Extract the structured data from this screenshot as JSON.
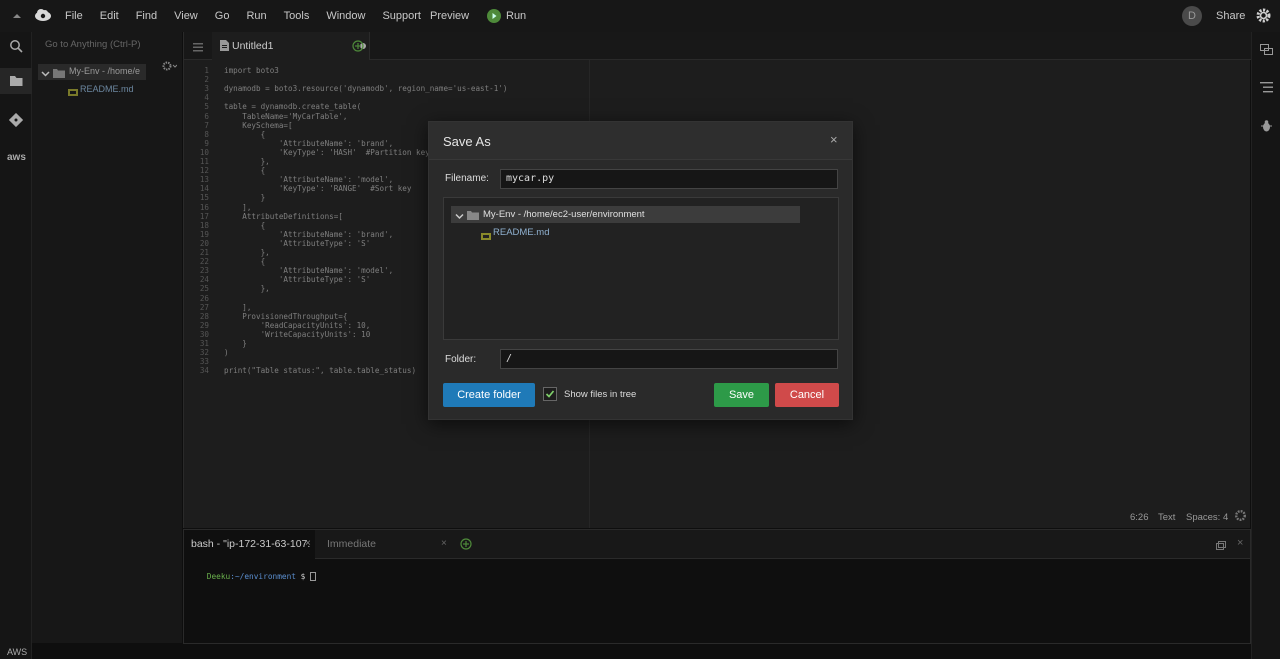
{
  "menubar": {
    "items": [
      "File",
      "Edit",
      "Find",
      "View",
      "Go",
      "Run",
      "Tools",
      "Window",
      "Support"
    ],
    "preview": "Preview",
    "run": "Run",
    "avatar_letter": "D",
    "share": "Share"
  },
  "tree": {
    "search_placeholder": "Go to Anything (Ctrl-P)",
    "root": "My-Env - /home/e",
    "file": "README.md"
  },
  "editor": {
    "tab_title": "Untitled1",
    "lines": [
      "import boto3",
      "",
      "dynamodb = boto3.resource('dynamodb', region_name='us-east-1')",
      "",
      "table = dynamodb.create_table(",
      "    TableName='MyCarTable',",
      "    KeySchema=[",
      "        {",
      "            'AttributeName': 'brand',",
      "            'KeyType': 'HASH'  #Partition key",
      "        },",
      "        {",
      "            'AttributeName': 'model',",
      "            'KeyType': 'RANGE'  #Sort key",
      "        }",
      "    ],",
      "    AttributeDefinitions=[",
      "        {",
      "            'AttributeName': 'brand',",
      "            'AttributeType': 'S'",
      "        },",
      "        {",
      "            'AttributeName': 'model',",
      "            'AttributeType': 'S'",
      "        },",
      "",
      "    ],",
      "    ProvisionedThroughput={",
      "        'ReadCapacityUnits': 10,",
      "        'WriteCapacityUnits': 10",
      "    }",
      ")",
      "",
      "print(\"Table status:\", table.table_status)"
    ],
    "status": {
      "position": "6:26",
      "mode": "Text",
      "spaces": "Spaces: 4"
    }
  },
  "terminal": {
    "tab1": "bash - \"ip-172-31-63-107.",
    "tab2": "Immediate",
    "prompt_user": "Deeku",
    "prompt_path": ":~/environment",
    "prompt_sym": " $ "
  },
  "footer": {
    "label": "AWS"
  },
  "dialog": {
    "title": "Save As",
    "close": "×",
    "filename_label": "Filename:",
    "filename_value": "mycar.py",
    "tree_root": "My-Env - /home/ec2-user/environment",
    "tree_file": "README.md",
    "folder_label": "Folder:",
    "folder_value": "/",
    "create_folder": "Create folder",
    "show_files": "Show files in tree",
    "save": "Save",
    "cancel": "Cancel"
  },
  "colors": {
    "save": "#2d9a48",
    "cancel": "#d04a4a",
    "create": "#1f7ab8"
  }
}
